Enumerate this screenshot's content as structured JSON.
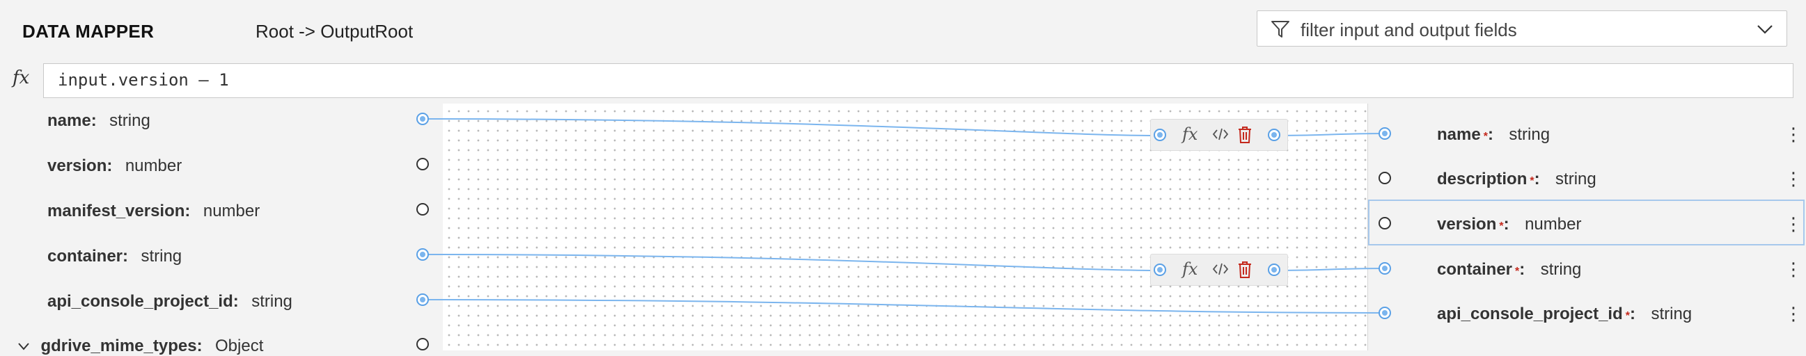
{
  "header": {
    "app_title": "DATA MAPPER",
    "breadcrumb": "Root -> OutputRoot",
    "filter_placeholder": "filter input and output fields"
  },
  "expression": {
    "fx_label": "fx",
    "value": "input.version – 1"
  },
  "input_fields": [
    {
      "name": "name:",
      "type": "string",
      "linked": true
    },
    {
      "name": "version:",
      "type": "number",
      "linked": false
    },
    {
      "name": "manifest_version:",
      "type": "number",
      "linked": false
    },
    {
      "name": "container:",
      "type": "string",
      "linked": true
    },
    {
      "name": "api_console_project_id:",
      "type": "string",
      "linked": true
    },
    {
      "name": "gdrive_mime_types:",
      "type": "Object",
      "linked": false,
      "collapsible": true
    }
  ],
  "output_fields": [
    {
      "name": "name",
      "required": "*",
      "colon": ":",
      "type": "string",
      "linked": true
    },
    {
      "name": "description",
      "required": "*",
      "colon": ":",
      "type": "string",
      "linked": false
    },
    {
      "name": "version",
      "required": "*",
      "colon": ":",
      "type": "number",
      "linked": false,
      "selected": true
    },
    {
      "name": "container",
      "required": "*",
      "colon": ":",
      "type": "string",
      "linked": true
    },
    {
      "name": "api_console_project_id",
      "required": "*",
      "colon": ":",
      "type": "string",
      "linked": true
    }
  ],
  "link_toolbar": {
    "fx_label": "fx",
    "icons": [
      "expression-icon",
      "code-icon",
      "delete-icon"
    ]
  },
  "colors": {
    "link": "#7bb5ee",
    "delete": "#c4281c",
    "selection": "#a6c8ec"
  }
}
